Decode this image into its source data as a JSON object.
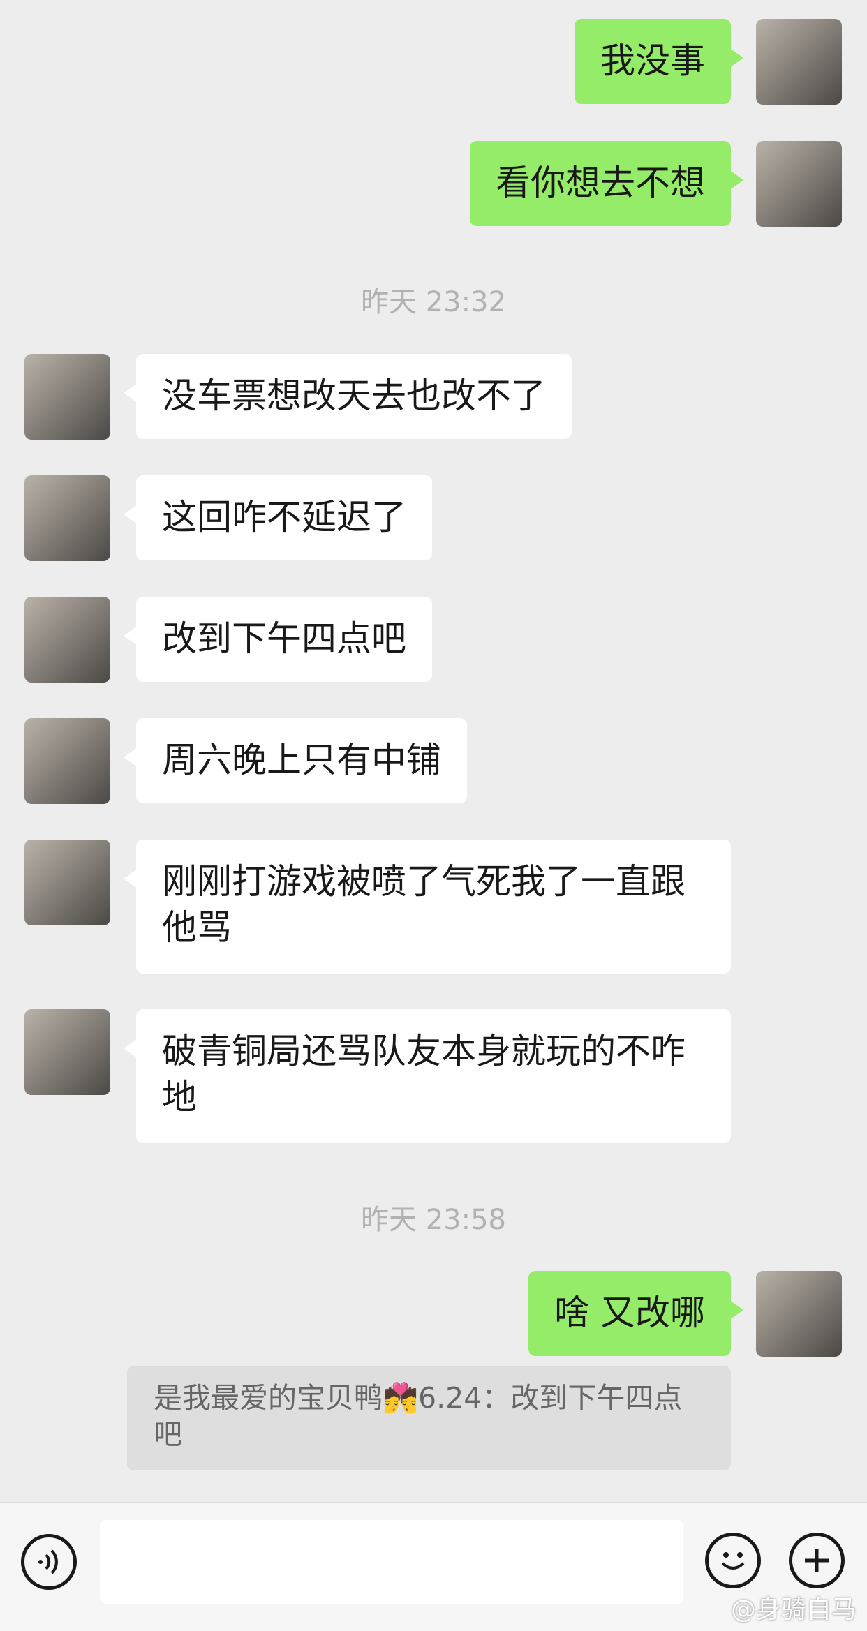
{
  "messages": [
    {
      "side": "me",
      "text": "我没事"
    },
    {
      "side": "me",
      "text": "看你想去不想"
    },
    {
      "type": "time",
      "text": "昨天 23:32"
    },
    {
      "side": "them",
      "text": "没车票想改天去也改不了"
    },
    {
      "side": "them",
      "text": "这回咋不延迟了"
    },
    {
      "side": "them",
      "text": "改到下午四点吧"
    },
    {
      "side": "them",
      "text": "周六晚上只有中铺"
    },
    {
      "side": "them",
      "text": "刚刚打游戏被喷了气死我了一直跟他骂"
    },
    {
      "side": "them",
      "text": "破青铜局还骂队友本身就玩的不咋地"
    },
    {
      "type": "time",
      "text": "昨天 23:58"
    },
    {
      "side": "me",
      "text": "啥 又改哪"
    }
  ],
  "quote": {
    "text": "是我最爱的宝贝鸭💏6.24：改到下午四点吧"
  },
  "toolbar": {
    "voice_icon": "voice-icon",
    "emoji_icon": "emoji-icon",
    "add_icon": "plus-icon"
  },
  "watermark": "@身骑自马",
  "colors": {
    "my_bubble": "#95ec69",
    "their_bubble": "#ffffff",
    "background": "#ededed"
  }
}
